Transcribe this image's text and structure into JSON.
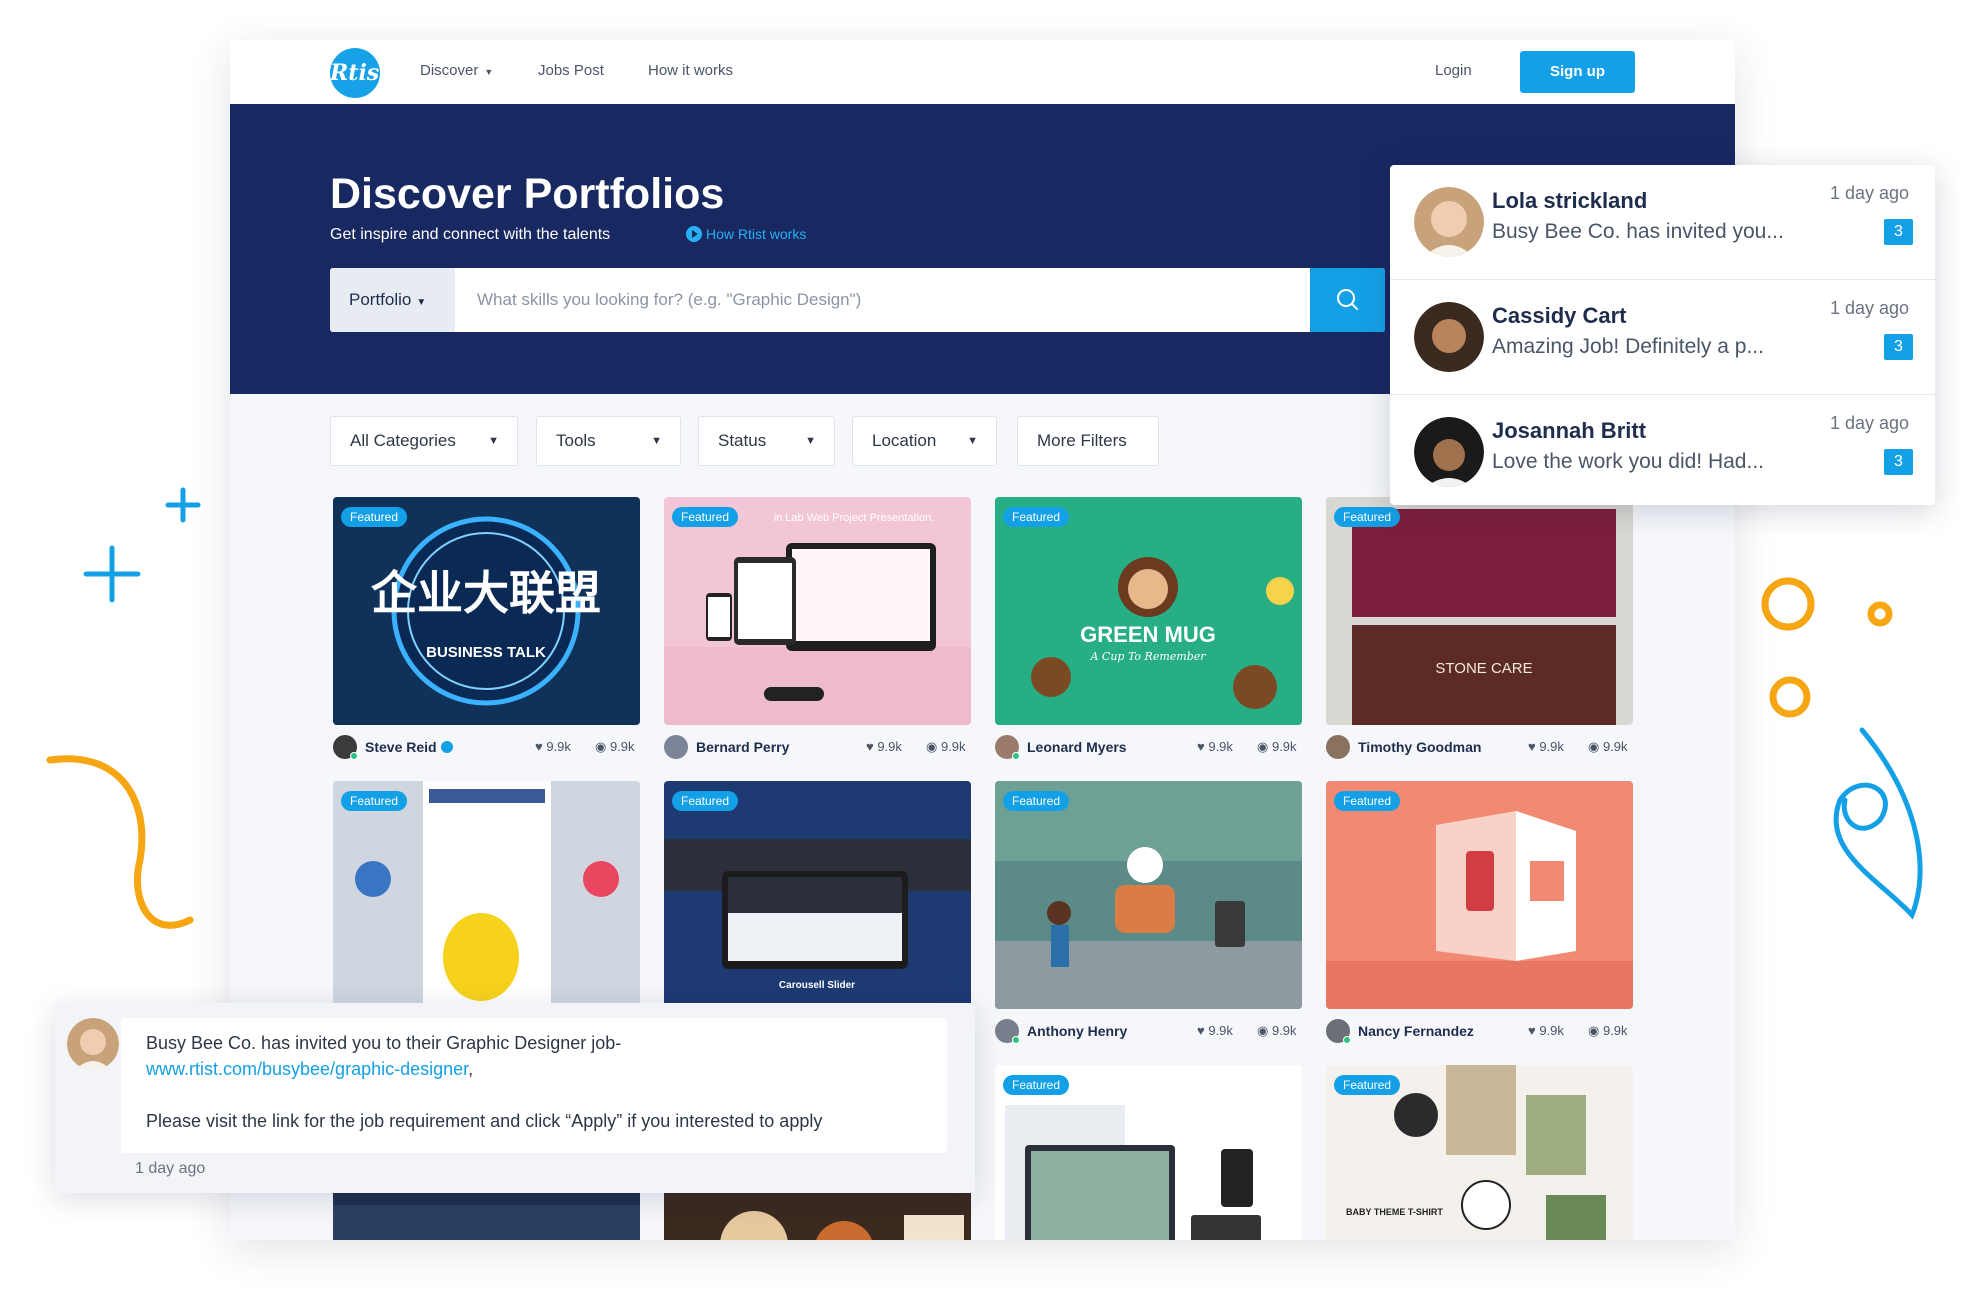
{
  "nav": {
    "logo": "Rtist",
    "links": [
      {
        "label": "Discover",
        "has_caret": true
      },
      {
        "label": "Jobs Post",
        "has_caret": false
      },
      {
        "label": "How it works",
        "has_caret": false
      }
    ],
    "login_label": "Login",
    "signup_label": "Sign up"
  },
  "hero": {
    "title": "Discover Portfolios",
    "subtitle": "Get inspire and connect with the talents",
    "help_link": "How Rtist works"
  },
  "search": {
    "type_label": "Portfolio",
    "placeholder": "What skills you looking for? (e.g. \"Graphic Design\")",
    "button_icon": "search-icon"
  },
  "filters": [
    {
      "label": "All Categories"
    },
    {
      "label": "Tools"
    },
    {
      "label": "Status"
    },
    {
      "label": "Location"
    },
    {
      "label": "More Filters"
    }
  ],
  "cards": [
    {
      "badge": "Featured",
      "author": "Steve Reid",
      "likes": "9.9k",
      "views": "9.9k",
      "verified": true,
      "image_text": "BUSINESS TALK",
      "image_alt": "企业大联盟 business talk logo"
    },
    {
      "badge": "Featured",
      "author": "Bernard Perry",
      "likes": "9.9k",
      "views": "9.9k",
      "verified": false,
      "image_text": "in Lab Web Project Presentation.",
      "image_alt": "responsive web project mockup"
    },
    {
      "badge": "Featured",
      "author": "Leonard Myers",
      "likes": "9.9k",
      "views": "9.9k",
      "verified": false,
      "image_text": "GREEN MUG",
      "image_subtext": "A Cup To Remember",
      "image_alt": "green mug branding"
    },
    {
      "badge": "Featured",
      "author": "Timothy Goodman",
      "likes": "9.9k",
      "views": "9.9k",
      "verified": false,
      "image_text": "STONE CARE",
      "image_alt": "stone care menu design"
    },
    {
      "badge": "Featured",
      "author": "",
      "likes": "",
      "views": "",
      "verified": false,
      "image_text": "",
      "image_alt": "social media app mockup"
    },
    {
      "badge": "Featured",
      "author": "",
      "likes": "",
      "views": "",
      "verified": false,
      "image_text": "Carousell Slider",
      "image_alt": "carousel slider web mockup"
    },
    {
      "badge": "Featured",
      "author": "Anthony Henry",
      "likes": "9.9k",
      "views": "9.9k",
      "verified": false,
      "image_text": "",
      "image_alt": "animated park scene illustration"
    },
    {
      "badge": "Featured",
      "author": "Nancy Fernandez",
      "likes": "9.9k",
      "views": "9.9k",
      "verified": false,
      "image_text": "",
      "image_alt": "brochure illustration on pink background"
    },
    {
      "badge": "",
      "author": "",
      "likes": "",
      "views": "",
      "verified": false,
      "image_text": "",
      "image_alt": "dark interior photo"
    },
    {
      "badge": "",
      "author": "",
      "likes": "",
      "views": "",
      "verified": false,
      "image_text": "",
      "image_alt": "food photography"
    },
    {
      "badge": "Featured",
      "author": "",
      "likes": "",
      "views": "",
      "verified": false,
      "image_text": "",
      "image_alt": "website layout mockup"
    },
    {
      "badge": "Featured",
      "author": "",
      "likes": "",
      "views": "",
      "verified": false,
      "image_text": "BABY THEME T-SHIRT",
      "image_alt": "baby theme t-shirt illustrations"
    }
  ],
  "notifications": [
    {
      "name": "Lola strickland",
      "message": "Busy Bee Co. has invited you...",
      "time": "1 day ago",
      "count": "3"
    },
    {
      "name": "Cassidy Cart",
      "message": "Amazing Job! Definitely a p...",
      "time": "1 day ago",
      "count": "3"
    },
    {
      "name": "Josannah Britt",
      "message": "Love the work you did! Had...",
      "time": "1 day ago",
      "count": "3"
    }
  ],
  "chat": {
    "line1": "Busy Bee Co. has invited you to their Graphic Designer job-",
    "link": "www.rtist.com/busybee/graphic-designer",
    "link_suffix": ",",
    "line3": "Please visit the link for the job requirement and click “Apply” if you interested to apply",
    "time": "1 day ago"
  },
  "colors": {
    "primary": "#14a0e6",
    "hero_bg": "#182861",
    "accent_orange": "#f7a613"
  }
}
